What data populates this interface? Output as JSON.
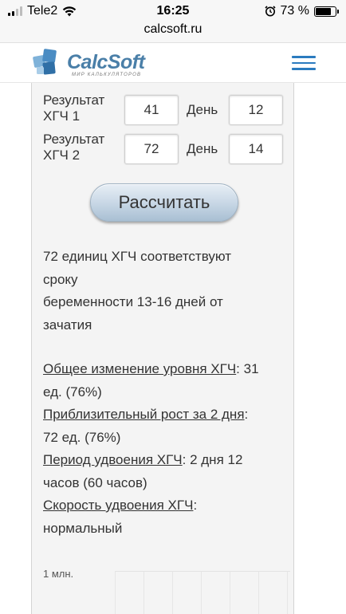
{
  "status_bar": {
    "carrier": "Tele2",
    "time": "16:25",
    "battery_text": "73 %",
    "battery_level": 0.73
  },
  "url": "calcsoft.ru",
  "header": {
    "logo_text": "CalcSoft",
    "logo_subtitle": "МИР КАЛЬКУЛЯТОРОВ"
  },
  "form": {
    "rows": [
      {
        "label_line1": "Результат",
        "label_line2": "ХГЧ 1",
        "value": "41",
        "day_label": "День",
        "day_value": "12"
      },
      {
        "label_line1": "Результат",
        "label_line2": "ХГЧ 2",
        "value": "72",
        "day_label": "День",
        "day_value": "14"
      }
    ],
    "calculate_label": "Рассчитать"
  },
  "result": {
    "line1": "72 единиц ХГЧ соответствуют",
    "line2": "сроку",
    "line3": "беременности 13-16 дней от",
    "line4": "зачатия"
  },
  "details": [
    {
      "label": "Общее изменение уровня ХГЧ",
      "value_line1": ": 31",
      "value_line2": "ед. (76%)"
    },
    {
      "label": "Приблизительный рост за 2 дня",
      "value_line1": ":",
      "value_line2": "72 ед. (76%)"
    },
    {
      "label": "Период удвоения ХГЧ",
      "value_line1": ": 2 дня 12",
      "value_line2": "часов (60 часов)"
    },
    {
      "label": "Скорость удвоения ХГЧ",
      "value_line1": ":",
      "value_line2": "нормальный"
    }
  ],
  "chart": {
    "y_label": "1 млн."
  }
}
